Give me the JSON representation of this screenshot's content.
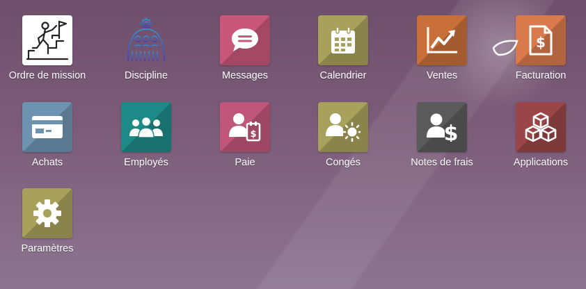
{
  "apps": [
    {
      "label": "Ordre de mission",
      "icon": "climbing-flag-icon",
      "color": "#ffffff"
    },
    {
      "label": "Discipline",
      "icon": "team-gear-icon",
      "color": "transparent"
    },
    {
      "label": "Messages",
      "icon": "chat-bubble-icon",
      "color": "#c8577a"
    },
    {
      "label": "Calendrier",
      "icon": "calendar-icon",
      "color": "#a8a15c"
    },
    {
      "label": "Ventes",
      "icon": "trend-chart-icon",
      "color": "#c96f3a"
    },
    {
      "label": "Facturation",
      "icon": "invoice-dollar-icon",
      "color": "#d97a4c"
    },
    {
      "label": "Achats",
      "icon": "credit-card-icon",
      "color": "#6e93b0"
    },
    {
      "label": "Employés",
      "icon": "people-group-icon",
      "color": "#1e8a87"
    },
    {
      "label": "Paie",
      "icon": "user-payslip-icon",
      "color": "#c0577a"
    },
    {
      "label": "Congés",
      "icon": "user-sun-icon",
      "color": "#a8a15c"
    },
    {
      "label": "Notes de frais",
      "icon": "user-dollar-icon",
      "color": "#5a5a5a"
    },
    {
      "label": "Applications",
      "icon": "cubes-icon",
      "color": "#9a4648"
    },
    {
      "label": "Paramètres",
      "icon": "gear-icon",
      "color": "#a8a15c"
    }
  ]
}
